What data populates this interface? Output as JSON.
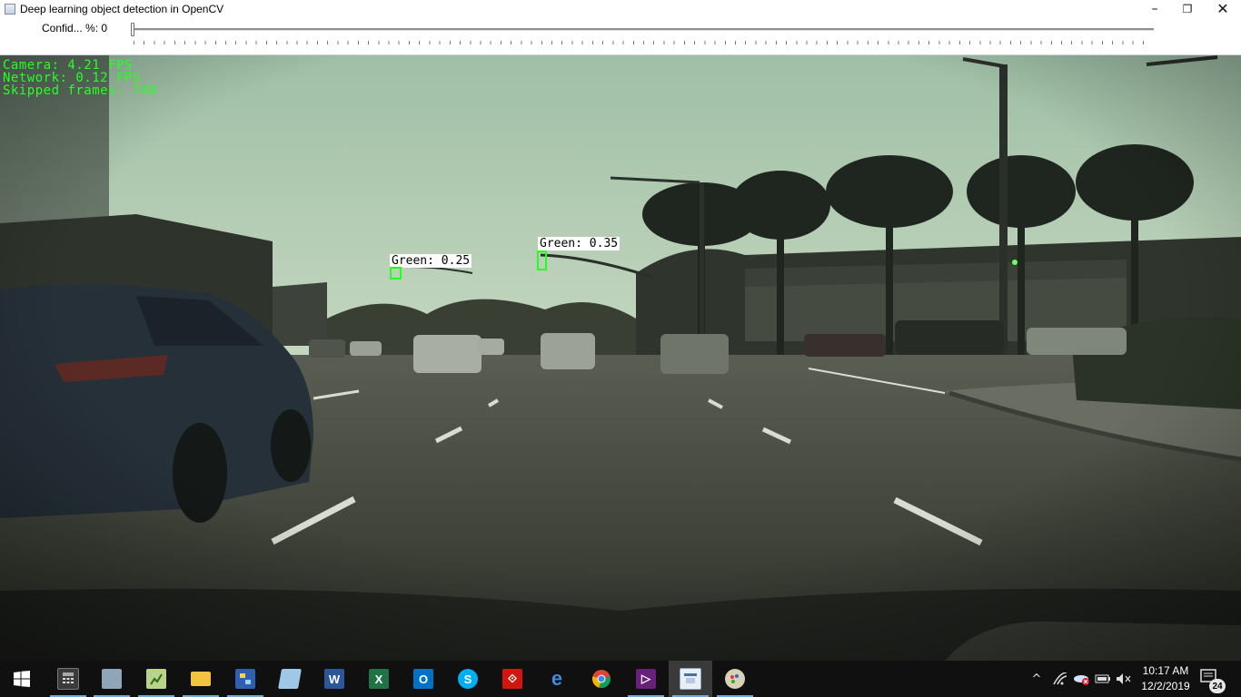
{
  "window": {
    "title": "Deep learning object detection in OpenCV",
    "minimize_glyph": "–",
    "maximize_glyph": "❐",
    "close_glyph": "✕"
  },
  "trackbar": {
    "label": "Confid... %: 0",
    "value": 0,
    "min": 0,
    "max": 100
  },
  "overlay": {
    "camera": "Camera: 4.21 FPS",
    "network": "Network: 0.12 FPS",
    "skipped": "Skipped frames: 748",
    "color": "#26ff26"
  },
  "detections": [
    {
      "label": "Green: 0.25",
      "class": "Green",
      "confidence": 0.25
    },
    {
      "label": "Green: 0.35",
      "class": "Green",
      "confidence": 0.35
    }
  ],
  "taskbar": {
    "start_icon": "windows-start-icon",
    "pinned": [
      "calculator-icon",
      "system-tool-icon",
      "notepad-chart-icon",
      "file-explorer-icon",
      "network-tool-icon",
      "book-reader-icon",
      "word-icon",
      "excel-icon",
      "outlook-icon",
      "skype-icon",
      "acrobat-icon",
      "edge-icon",
      "chrome-icon",
      "visual-studio-icon",
      "opencv-window-icon",
      "paint-icon"
    ],
    "tray": {
      "clock_time": "10:17 AM",
      "clock_date": "12/2/2019",
      "notification_count": "24"
    }
  }
}
